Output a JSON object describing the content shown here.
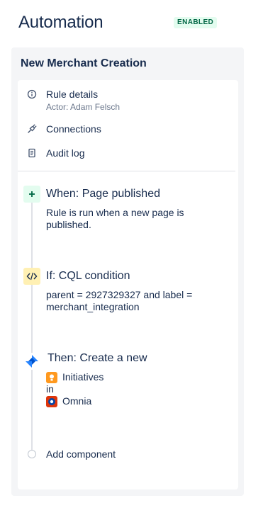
{
  "header": {
    "title": "Automation",
    "status_badge": "ENABLED"
  },
  "rule": {
    "name": "New Merchant Creation",
    "menu": [
      {
        "label": "Rule details",
        "subtitle": "Actor: Adam Felsch",
        "icon": "info-icon"
      },
      {
        "label": "Connections",
        "icon": "plug-icon"
      },
      {
        "label": "Audit log",
        "icon": "document-icon"
      }
    ],
    "steps": {
      "trigger": {
        "title": "When: Page published",
        "description": "Rule is run when a new page is published.",
        "icon": "plus-icon",
        "color": "#e3fcef"
      },
      "condition": {
        "title": "If: CQL condition",
        "description": "parent = 2927329327 and label = merchant_integration",
        "icon": "code-icon",
        "color": "#fff0b3"
      },
      "action": {
        "title": "Then: Create a new",
        "issue_type": "Initiatives",
        "connector": "in",
        "project": "Omnia",
        "icon": "jira-icon",
        "color": "#2684ff"
      }
    },
    "add_component_label": "Add component"
  }
}
